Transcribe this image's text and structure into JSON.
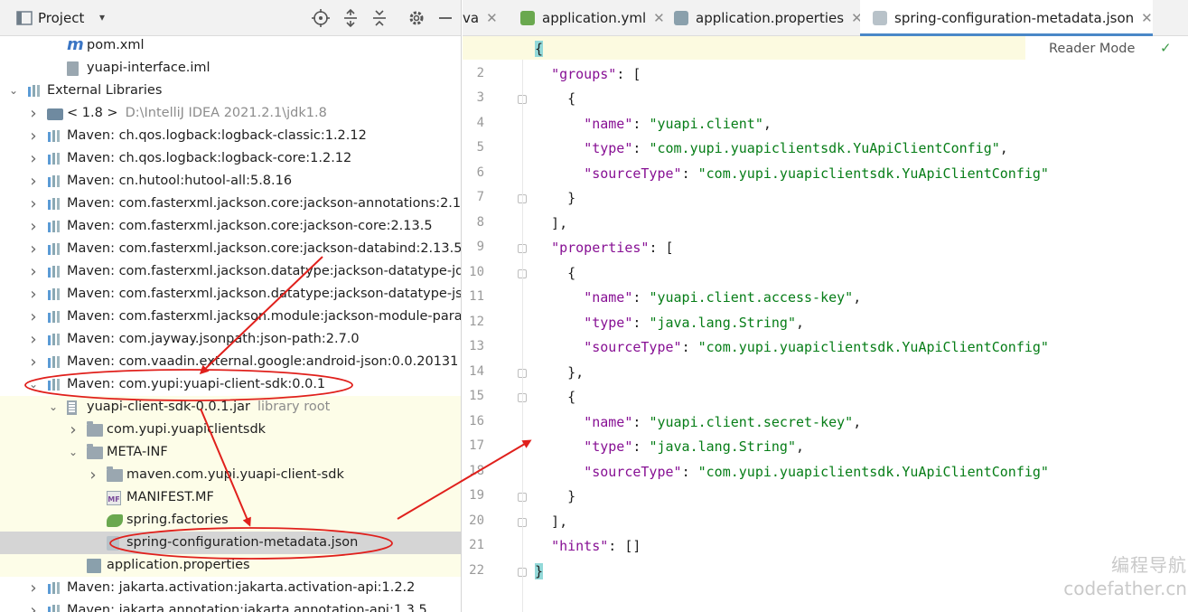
{
  "project_panel": {
    "title": "Project",
    "chevron": "▾",
    "toolbar_icons": [
      "crosshair-icon",
      "expand-all-icon",
      "collapse-all-icon",
      "gear-icon",
      "minimize-icon"
    ]
  },
  "tree": [
    {
      "label": "pom.xml",
      "icon": "maven-icon",
      "indent": 2,
      "arrow": ""
    },
    {
      "label": "yuapi-interface.iml",
      "icon": "file-icon",
      "indent": 2,
      "arrow": ""
    },
    {
      "label": "External Libraries",
      "icon": "library-icon",
      "indent": 0,
      "arrow": "expanded"
    },
    {
      "label": "< 1.8 >",
      "extra": "D:\\IntelliJ IDEA 2021.2.1\\jdk1.8",
      "icon": "jdk-icon",
      "indent": 1,
      "arrow": "collapsed"
    },
    {
      "label": "Maven: ch.qos.logback:logback-classic:1.2.12",
      "icon": "library-icon",
      "indent": 1,
      "arrow": "collapsed"
    },
    {
      "label": "Maven: ch.qos.logback:logback-core:1.2.12",
      "icon": "library-icon",
      "indent": 1,
      "arrow": "collapsed"
    },
    {
      "label": "Maven: cn.hutool:hutool-all:5.8.16",
      "icon": "library-icon",
      "indent": 1,
      "arrow": "collapsed"
    },
    {
      "label": "Maven: com.fasterxml.jackson.core:jackson-annotations:2.1",
      "icon": "library-icon",
      "indent": 1,
      "arrow": "collapsed"
    },
    {
      "label": "Maven: com.fasterxml.jackson.core:jackson-core:2.13.5",
      "icon": "library-icon",
      "indent": 1,
      "arrow": "collapsed"
    },
    {
      "label": "Maven: com.fasterxml.jackson.core:jackson-databind:2.13.5",
      "icon": "library-icon",
      "indent": 1,
      "arrow": "collapsed"
    },
    {
      "label": "Maven: com.fasterxml.jackson.datatype:jackson-datatype-jd",
      "icon": "library-icon",
      "indent": 1,
      "arrow": "collapsed"
    },
    {
      "label": "Maven: com.fasterxml.jackson.datatype:jackson-datatype-js",
      "icon": "library-icon",
      "indent": 1,
      "arrow": "collapsed"
    },
    {
      "label": "Maven: com.fasterxml.jackson.module:jackson-module-para",
      "icon": "library-icon",
      "indent": 1,
      "arrow": "collapsed"
    },
    {
      "label": "Maven: com.jayway.jsonpath:json-path:2.7.0",
      "icon": "library-icon",
      "indent": 1,
      "arrow": "collapsed"
    },
    {
      "label": "Maven: com.vaadin.external.google:android-json:0.0.20131",
      "icon": "library-icon",
      "indent": 1,
      "arrow": "collapsed"
    },
    {
      "label": "Maven: com.yupi:yuapi-client-sdk:0.0.1",
      "icon": "library-icon",
      "indent": 1,
      "arrow": "expanded"
    },
    {
      "label": "yuapi-client-sdk-0.0.1.jar",
      "extra": "library root",
      "icon": "jar-icon",
      "indent": 2,
      "arrow": "expanded",
      "hl": true
    },
    {
      "label": "com.yupi.yuapiclientsdk",
      "icon": "folder-icon",
      "indent": 3,
      "arrow": "collapsed",
      "hl": true
    },
    {
      "label": "META-INF",
      "icon": "folder-icon",
      "indent": 3,
      "arrow": "expanded",
      "hl": true
    },
    {
      "label": "maven.com.yupi.yuapi-client-sdk",
      "icon": "folder-icon",
      "indent": 4,
      "arrow": "collapsed",
      "hl": true
    },
    {
      "label": "MANIFEST.MF",
      "icon": "manifest-icon",
      "indent": 4,
      "arrow": "",
      "hl": true
    },
    {
      "label": "spring.factories",
      "icon": "spring-leaf-icon",
      "indent": 4,
      "arrow": "",
      "hl": true
    },
    {
      "label": "spring-configuration-metadata.json",
      "icon": "json-file-icon",
      "indent": 4,
      "arrow": "",
      "sel": true
    },
    {
      "label": "application.properties",
      "icon": "properties-icon",
      "indent": 3,
      "arrow": "",
      "hl": true
    },
    {
      "label": "Maven: jakarta.activation:jakarta.activation-api:1.2.2",
      "icon": "library-icon",
      "indent": 1,
      "arrow": "collapsed"
    },
    {
      "label": "Maven: jakarta.annotation:jakarta.annotation-api:1.3.5",
      "icon": "library-icon",
      "indent": 1,
      "arrow": "collapsed"
    }
  ],
  "tabs": [
    {
      "label": "va",
      "icon": "",
      "active": false
    },
    {
      "label": "application.yml",
      "icon": "yml-icon",
      "active": false
    },
    {
      "label": "application.properties",
      "icon": "properties-icon",
      "active": false
    },
    {
      "label": "spring-configuration-metadata.json",
      "icon": "json-file-icon",
      "active": true
    }
  ],
  "tab_close": "✕",
  "editor": {
    "reader_mode": "Reader Mode",
    "check": "✓",
    "lines": [
      [
        [
          "{",
          "punct"
        ]
      ],
      [
        [
          "  ",
          ""
        ],
        [
          "\"groups\"",
          "key"
        ],
        [
          ": [",
          "punct"
        ]
      ],
      [
        [
          "    {",
          "punct"
        ]
      ],
      [
        [
          "      ",
          ""
        ],
        [
          "\"name\"",
          "key"
        ],
        [
          ": ",
          "punct"
        ],
        [
          "\"yuapi.client\"",
          "str"
        ],
        [
          ",",
          "punct"
        ]
      ],
      [
        [
          "      ",
          ""
        ],
        [
          "\"type\"",
          "key"
        ],
        [
          ": ",
          "punct"
        ],
        [
          "\"com.yupi.yuapiclientsdk.YuApiClientConfig\"",
          "str"
        ],
        [
          ",",
          "punct"
        ]
      ],
      [
        [
          "      ",
          ""
        ],
        [
          "\"sourceType\"",
          "key"
        ],
        [
          ": ",
          "punct"
        ],
        [
          "\"com.yupi.yuapiclientsdk.YuApiClientConfig\"",
          "str"
        ]
      ],
      [
        [
          "    }",
          "punct"
        ]
      ],
      [
        [
          "  ],",
          "punct"
        ]
      ],
      [
        [
          "  ",
          ""
        ],
        [
          "\"properties\"",
          "key"
        ],
        [
          ": [",
          "punct"
        ]
      ],
      [
        [
          "    {",
          "punct"
        ]
      ],
      [
        [
          "      ",
          ""
        ],
        [
          "\"name\"",
          "key"
        ],
        [
          ": ",
          "punct"
        ],
        [
          "\"yuapi.client.access-key\"",
          "str"
        ],
        [
          ",",
          "punct"
        ]
      ],
      [
        [
          "      ",
          ""
        ],
        [
          "\"type\"",
          "key"
        ],
        [
          ": ",
          "punct"
        ],
        [
          "\"java.lang.String\"",
          "str"
        ],
        [
          ",",
          "punct"
        ]
      ],
      [
        [
          "      ",
          ""
        ],
        [
          "\"sourceType\"",
          "key"
        ],
        [
          ": ",
          "punct"
        ],
        [
          "\"com.yupi.yuapiclientsdk.YuApiClientConfig\"",
          "str"
        ]
      ],
      [
        [
          "    },",
          "punct"
        ]
      ],
      [
        [
          "    {",
          "punct"
        ]
      ],
      [
        [
          "      ",
          ""
        ],
        [
          "\"name\"",
          "key"
        ],
        [
          ": ",
          "punct"
        ],
        [
          "\"yuapi.client.secret-key\"",
          "str"
        ],
        [
          ",",
          "punct"
        ]
      ],
      [
        [
          "      ",
          ""
        ],
        [
          "\"type\"",
          "key"
        ],
        [
          ": ",
          "punct"
        ],
        [
          "\"java.lang.String\"",
          "str"
        ],
        [
          ",",
          "punct"
        ]
      ],
      [
        [
          "      ",
          ""
        ],
        [
          "\"sourceType\"",
          "key"
        ],
        [
          ": ",
          "punct"
        ],
        [
          "\"com.yupi.yuapiclientsdk.YuApiClientConfig\"",
          "str"
        ]
      ],
      [
        [
          "    }",
          "punct"
        ]
      ],
      [
        [
          "  ],",
          "punct"
        ]
      ],
      [
        [
          "  ",
          ""
        ],
        [
          "\"hints\"",
          "key"
        ],
        [
          ": []",
          "punct"
        ]
      ],
      [
        [
          "}",
          "punct"
        ]
      ]
    ]
  },
  "watermark": {
    "line1": "编程导航",
    "line2": "codefather.cn"
  },
  "colors": {
    "annotation_red": "#e0201c",
    "key": "#871094",
    "string": "#067d17",
    "selection": "#d5d5d5"
  }
}
